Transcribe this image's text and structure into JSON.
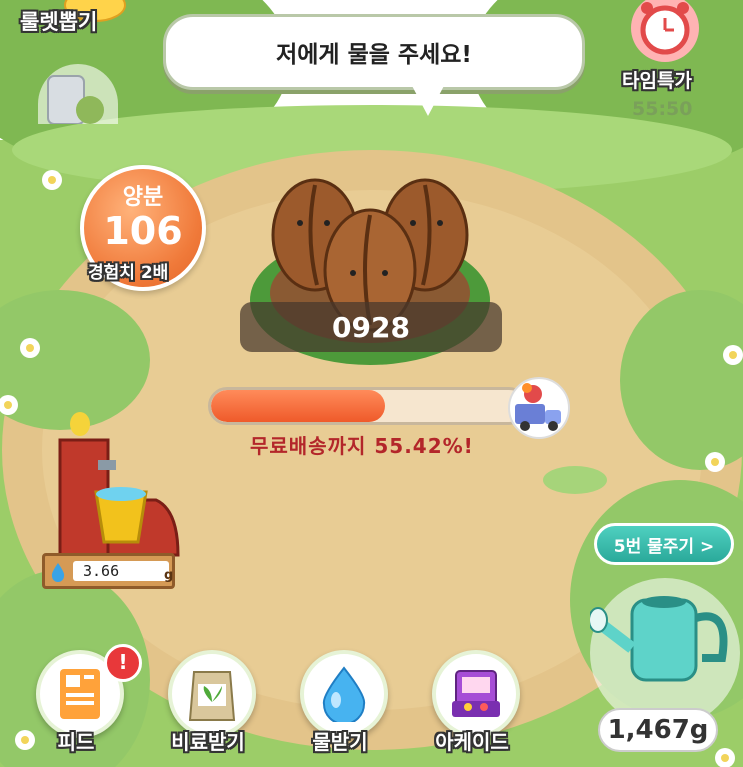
{
  "speech_bubble": {
    "text": "저에게 물을 주세요!"
  },
  "top_left": {
    "roulette_label": "룰렛뽑기"
  },
  "time_deal": {
    "label": "타임특가",
    "timer": "55:50"
  },
  "nutrient": {
    "label": "양분",
    "value": "106",
    "exp_label": "경험치 2배"
  },
  "plant": {
    "counter": "0928"
  },
  "progress": {
    "fraction": 0.5542,
    "text": "무료배송까지 55.42%!"
  },
  "well": {
    "water_value": "3.66",
    "unit": "g"
  },
  "water_action": {
    "button_label": "5번 물주기 >",
    "amount": "1,467g"
  },
  "bottom_buttons": [
    {
      "label": "피드",
      "icon": "feed-icon",
      "badge": "!"
    },
    {
      "label": "비료받기",
      "icon": "fertilizer-bag-icon"
    },
    {
      "label": "물받기",
      "icon": "water-drop-icon"
    },
    {
      "label": "아케이드",
      "icon": "arcade-icon"
    }
  ],
  "colors": {
    "accent_orange": "#f07a3a",
    "teal": "#2aa99a",
    "progress_text": "#b3262a"
  }
}
